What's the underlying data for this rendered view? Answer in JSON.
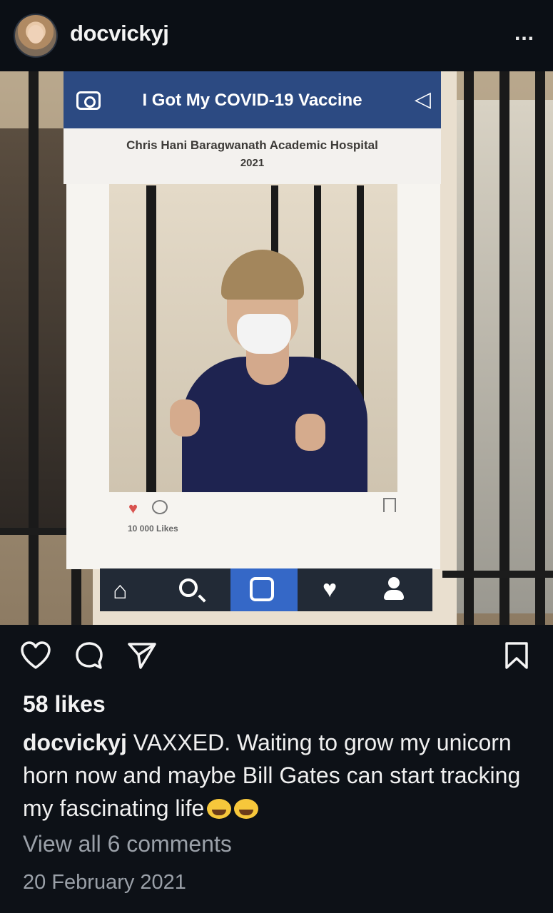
{
  "header": {
    "username": "docvickyj",
    "more_label": "..."
  },
  "photo": {
    "frame_title": "I Got My COVID-19 Vaccine",
    "frame_hospital": "Chris Hani Baragwanath Academic Hospital",
    "frame_year": "2021",
    "frame_likes": "10 000 Likes"
  },
  "post": {
    "likes": "58 likes",
    "caption_user": "docvickyj",
    "caption_text": " VAXXED. Waiting to grow my unicorn horn now and maybe Bill Gates can start tracking my fascinating life",
    "view_comments": "View all 6 comments",
    "date": "20 February 2021"
  },
  "icons": {
    "heart": "heart-icon",
    "comment": "comment-icon",
    "send": "send-icon",
    "bookmark": "bookmark-icon"
  }
}
